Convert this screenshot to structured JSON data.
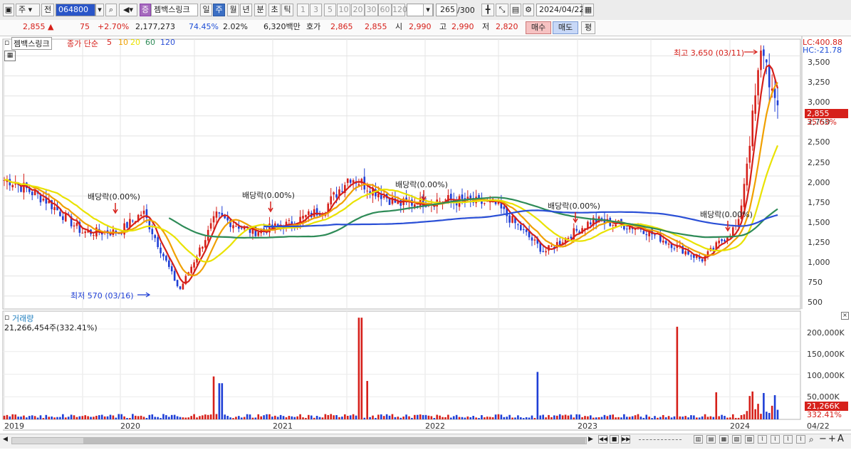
{
  "toolbar": {
    "period_type": "주",
    "prev_label": "전",
    "code": "064800",
    "stock_name": "젬백스링크",
    "stock_badge": "증",
    "periods": [
      "일",
      "주",
      "월",
      "년",
      "분",
      "초",
      "틱"
    ],
    "selected_period": "주",
    "intervals": [
      "1",
      "3",
      "5",
      "10",
      "20",
      "30",
      "60",
      "120"
    ],
    "count": "265",
    "count_total": "/300",
    "date": "2024/04/22"
  },
  "quote": {
    "price": "2,855",
    "arrow": "▲",
    "change": "75",
    "change_pct": "+2.70%",
    "volume": "2,177,273",
    "vol_ratio": "74.45%",
    "turnover": "2.02%",
    "amount": "6,320백만",
    "ask_label": "호가",
    "ask": "2,865",
    "bid": "2,855",
    "open_label": "시",
    "open": "2,990",
    "high_label": "고",
    "high": "2,990",
    "low_label": "저",
    "low": "2,820",
    "buy_label": "매수",
    "sell_label": "매도",
    "eval_label": "평"
  },
  "price_panel": {
    "name_tag": "젬백스링크",
    "legend_prefix": "종가 단순",
    "ma_periods": [
      "5",
      "10",
      "20",
      "60",
      "120"
    ],
    "ma_colors": [
      "#d6201a",
      "#f0a000",
      "#e9e200",
      "#2e8b57",
      "#2a4fd6"
    ],
    "lc": "LC:400.88",
    "hc": "HC:-21.78",
    "max_label": "최고 3,650 (03/11)",
    "min_label": "최저 570 (03/16)",
    "dividend_label": "배당락(0.00%)",
    "y_ticks": [
      "3,500",
      "3,250",
      "3,000",
      "2,750",
      "2,500",
      "2,250",
      "2,000",
      "1,750",
      "1,500",
      "1,250",
      "1,000",
      "750",
      "500"
    ],
    "current_price_tag": "2,855",
    "current_pct_tag": "35.63%"
  },
  "volume_panel": {
    "title": "거래량",
    "summary": "21,266,454주(332.41%)",
    "y_ticks": [
      "200,000K",
      "150,000K",
      "100,000K",
      "50,000K"
    ],
    "current_tag": "21,266K",
    "current_pct": "332.41%"
  },
  "x_axis": {
    "labels": [
      "2019",
      "2020",
      "2021",
      "2022",
      "2023",
      "2024"
    ],
    "end_label": "04/22"
  },
  "chart_data": {
    "type": "candlestick",
    "timeframe": "weekly",
    "symbol": "064800",
    "name": "젬백스링크",
    "y_unit": "KRW",
    "ylim": [
      400,
      3700
    ],
    "close_series_approx": [
      {
        "x": "2019-01",
        "y": 1950
      },
      {
        "x": "2019-04",
        "y": 1700
      },
      {
        "x": "2019-07",
        "y": 1300
      },
      {
        "x": "2019-10",
        "y": 1300
      },
      {
        "x": "2019-12",
        "y": 1550
      },
      {
        "x": "2020-03",
        "y": 570
      },
      {
        "x": "2020-06",
        "y": 1500
      },
      {
        "x": "2020-09",
        "y": 1300
      },
      {
        "x": "2020-12",
        "y": 1400
      },
      {
        "x": "2021-03",
        "y": 1600
      },
      {
        "x": "2021-05",
        "y": 2000
      },
      {
        "x": "2021-09",
        "y": 1650
      },
      {
        "x": "2022-01",
        "y": 1700
      },
      {
        "x": "2022-05",
        "y": 1650
      },
      {
        "x": "2022-09",
        "y": 1050
      },
      {
        "x": "2023-01",
        "y": 1450
      },
      {
        "x": "2023-05",
        "y": 1350
      },
      {
        "x": "2023-10",
        "y": 950
      },
      {
        "x": "2024-01",
        "y": 1400
      },
      {
        "x": "2024-03",
        "y": 3650
      },
      {
        "x": "2024-04",
        "y": 2855
      }
    ],
    "highest": {
      "value": 3650,
      "date": "03/11"
    },
    "lowest": {
      "value": 570,
      "date": "03/16"
    },
    "moving_averages": [
      5,
      10,
      20,
      60,
      120
    ],
    "volume_ylim": [
      0,
      230000
    ],
    "volume_unit": "K"
  }
}
